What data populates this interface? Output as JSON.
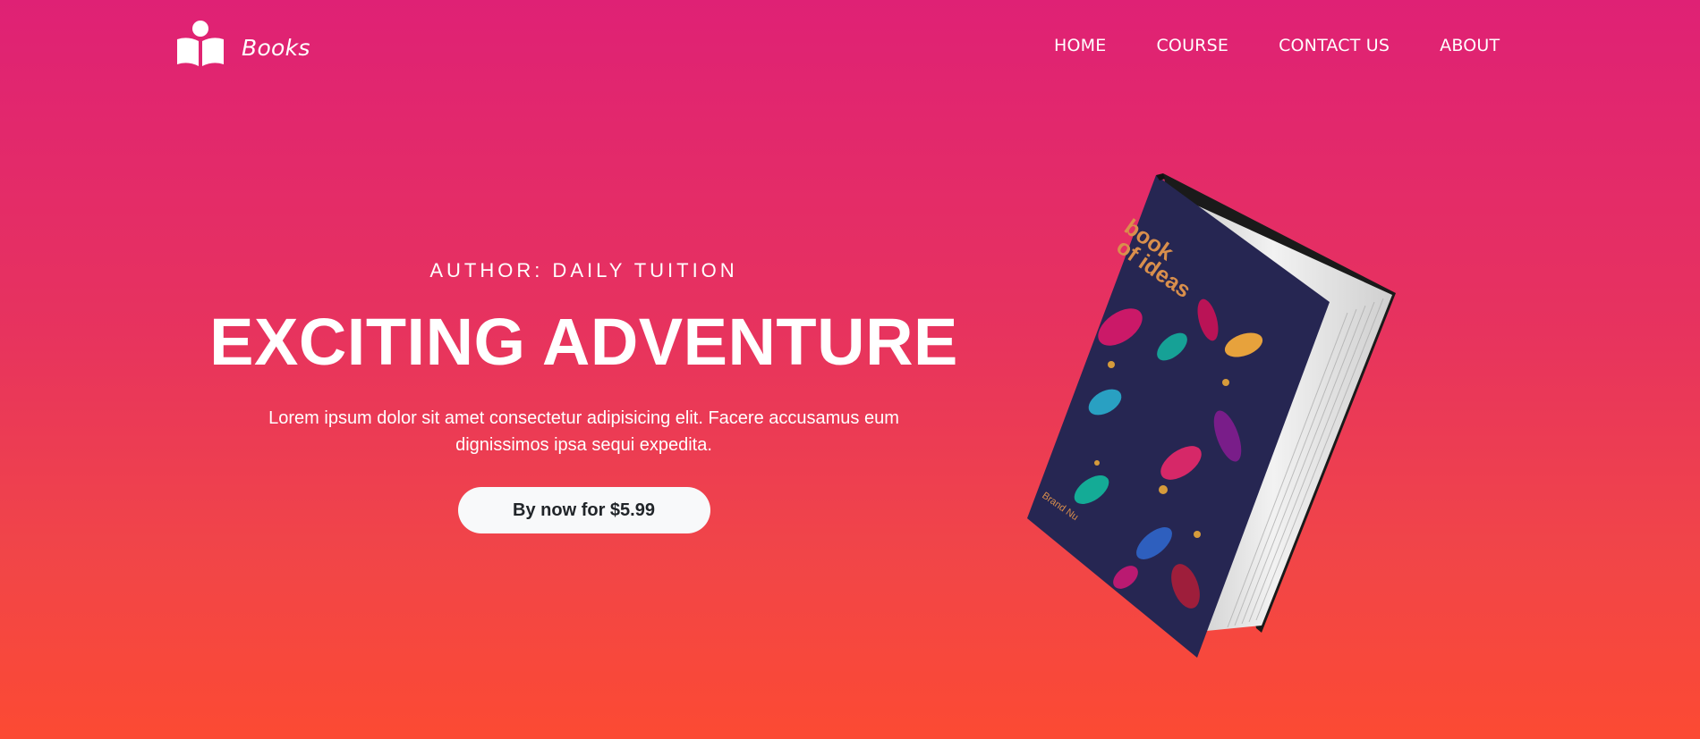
{
  "brand": {
    "name": "Books",
    "icon": "open-book-reader-icon",
    "color": "#ffffff"
  },
  "nav": {
    "items": [
      {
        "label": "HOME"
      },
      {
        "label": "COURSE"
      },
      {
        "label": "CONTACT US"
      },
      {
        "label": "ABOUT"
      }
    ]
  },
  "hero": {
    "author": "AUTHOR: DAILY TUITION",
    "title": "EXCITING ADVENTURE",
    "description": "Lorem ipsum dolor sit amet consectetur adipisicing elit. Facere accusamus eum dignissimos ipsa sequi expedita.",
    "cta_label": "By now for $5.99"
  },
  "book": {
    "icon": "book-cover-image",
    "cover_title_line1": "book",
    "cover_title_line2": "of ideas",
    "cover_brand": "Brand Nu"
  },
  "colors": {
    "gradient_top": "#df2175",
    "gradient_bottom": "#fc4a33",
    "button_bg": "#f8f9fa",
    "button_text": "#212529",
    "cover": "#262652"
  }
}
